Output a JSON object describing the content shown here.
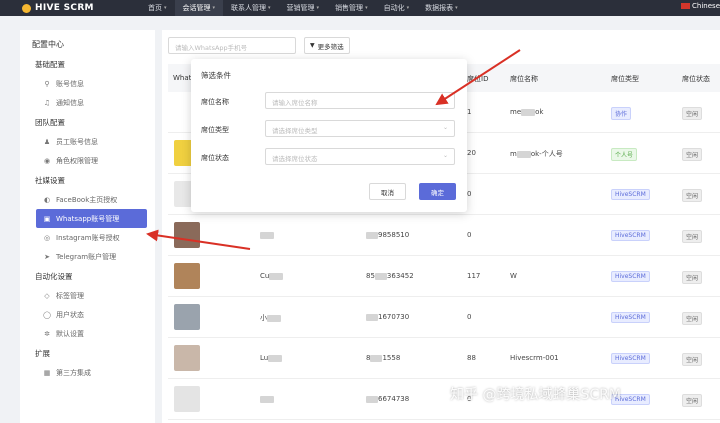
{
  "app": {
    "logo_text": "HIVE SCRM",
    "lang": "Chinese"
  },
  "nav": {
    "items": [
      {
        "label": "首页",
        "has_caret": true
      },
      {
        "label": "会话管理",
        "has_caret": true,
        "active": true
      },
      {
        "label": "联系人管理",
        "has_caret": true
      },
      {
        "label": "营销管理",
        "has_caret": true
      },
      {
        "label": "销售管理",
        "has_caret": true
      },
      {
        "label": "自动化",
        "has_caret": true
      },
      {
        "label": "数据报表",
        "has_caret": true
      }
    ]
  },
  "sidebar": {
    "title": "配置中心",
    "groups": [
      {
        "label": "基础配置",
        "items": [
          {
            "label": "账号信息",
            "icon": "user-icon"
          },
          {
            "label": "通知信息",
            "icon": "bell-icon"
          }
        ]
      },
      {
        "label": "团队配置",
        "items": [
          {
            "label": "员工账号信息",
            "icon": "team-icon"
          },
          {
            "label": "角色权限管理",
            "icon": "role-icon"
          }
        ]
      },
      {
        "label": "社媒设置",
        "items": [
          {
            "label": "FaceBook主页授权",
            "icon": "facebook-icon"
          },
          {
            "label": "Whatsapp账号管理",
            "icon": "whatsapp-icon",
            "active": true
          },
          {
            "label": "Instagram账号授权",
            "icon": "instagram-icon"
          },
          {
            "label": "Telegram账户管理",
            "icon": "telegram-icon"
          }
        ]
      },
      {
        "label": "自动化设置",
        "items": [
          {
            "label": "标签管理",
            "icon": "tag-icon"
          },
          {
            "label": "用户状态",
            "icon": "user-status-icon"
          },
          {
            "label": "默认设置",
            "icon": "settings-icon"
          }
        ]
      },
      {
        "label": "扩展",
        "items": [
          {
            "label": "第三方集成",
            "icon": "integration-icon"
          }
        ]
      }
    ]
  },
  "toolbar": {
    "search_placeholder": "请输入WhatsApp手机号",
    "filter_label": "更多筛选"
  },
  "table": {
    "headers": {
      "whatsapp": "What",
      "seat_id": "席位ID",
      "seat_name": "席位名称",
      "seat_type": "席位类型",
      "seat_status": "席位状态"
    },
    "rows": [
      {
        "name": "",
        "phone": "",
        "seat_id": "1",
        "seat_name_prefix": "me",
        "seat_name_suffix": "ok",
        "type": "协作",
        "type_color": "blue",
        "status": "空闲",
        "avatar_color": "#ffffff"
      },
      {
        "name": "",
        "phone": "",
        "seat_id": "20",
        "seat_name_prefix": "m",
        "seat_name_suffix": "ok-个人号",
        "type": "个人号",
        "type_color": "green",
        "status": "空闲",
        "avatar_color": "#f0d040"
      },
      {
        "name": "",
        "phone": "",
        "seat_id": "0",
        "seat_name_prefix": "",
        "seat_name_suffix": "",
        "type": "HiveSCRM",
        "type_color": "blue",
        "status": "空闲",
        "avatar_color": "#e8e8e8"
      },
      {
        "name": "",
        "phone_suffix": "9858510",
        "seat_id": "0",
        "seat_name_prefix": "",
        "seat_name_suffix": "",
        "type": "HiveSCRM",
        "type_color": "blue",
        "status": "空闲",
        "avatar_color": "#8a6a5a"
      },
      {
        "name": "Cu",
        "phone_prefix": "85",
        "phone_suffix": "363452",
        "seat_id": "117",
        "seat_name_prefix": "W",
        "seat_name_suffix": "",
        "type": "HiveSCRM",
        "type_color": "blue",
        "status": "空闲",
        "avatar_color": "#b0845a"
      },
      {
        "name": "小",
        "phone_suffix": "1670730",
        "seat_id": "0",
        "seat_name_prefix": "",
        "seat_name_suffix": "",
        "type": "HiveSCRM",
        "type_color": "blue",
        "status": "空闲",
        "avatar_color": "#9aa3ad"
      },
      {
        "name": "Lu",
        "phone_prefix": "8",
        "phone_suffix": "1558",
        "seat_id": "88",
        "seat_name_prefix": "Hivescrm-001",
        "seat_name_suffix": "",
        "type": "HiveSCRM",
        "type_color": "blue",
        "status": "空闲",
        "avatar_color": "#c9b7a9"
      },
      {
        "name": "",
        "phone_prefix": "",
        "phone_suffix": "6674738",
        "seat_id": "0",
        "seat_name_prefix": "",
        "seat_name_suffix": "",
        "type": "HiveSCRM",
        "type_color": "blue",
        "status": "空闲",
        "avatar_color": "#e4e4e4"
      }
    ]
  },
  "modal": {
    "title": "筛选条件",
    "fields": [
      {
        "label": "席位名称",
        "placeholder": "请输入席位名称",
        "kind": "input"
      },
      {
        "label": "席位类型",
        "placeholder": "请选择席位类型",
        "kind": "select"
      },
      {
        "label": "席位状态",
        "placeholder": "请选择席位状态",
        "kind": "select"
      }
    ],
    "cancel_label": "取消",
    "ok_label": "确定"
  },
  "watermark": "知乎 @跨境私域蜂巢SCRM",
  "colors": {
    "accent": "#5b6bd9",
    "topbar": "#2b2f3a",
    "arrow": "#d93025"
  }
}
